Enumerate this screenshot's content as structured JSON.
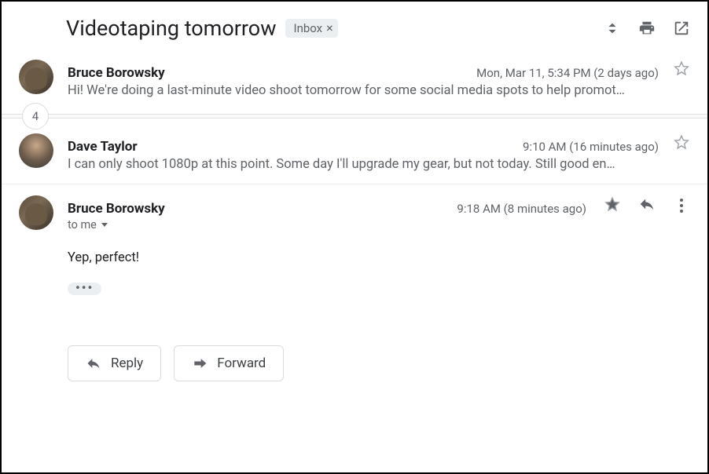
{
  "header": {
    "subject": "Videotaping tomorrow",
    "label": "Inbox"
  },
  "hidden_count": "4",
  "messages": {
    "m0": {
      "sender": "Bruce Borowsky",
      "timestamp": "Mon, Mar 11, 5:34 PM (2 days ago)",
      "snippet": "Hi! We're doing a last-minute video shoot tomorrow for some social media spots to help promot…"
    },
    "m1": {
      "sender": "Dave Taylor",
      "timestamp": "9:10 AM (16 minutes ago)",
      "snippet": "I can only shoot 1080p at this point. Some day I'll upgrade my gear, but not today. Still good en…"
    },
    "m2": {
      "sender": "Bruce Borowsky",
      "timestamp": "9:18 AM (8 minutes ago)",
      "to": "to me",
      "body": "Yep, perfect!"
    }
  },
  "trimmed": "•••",
  "actions": {
    "reply": "Reply",
    "forward": "Forward"
  }
}
